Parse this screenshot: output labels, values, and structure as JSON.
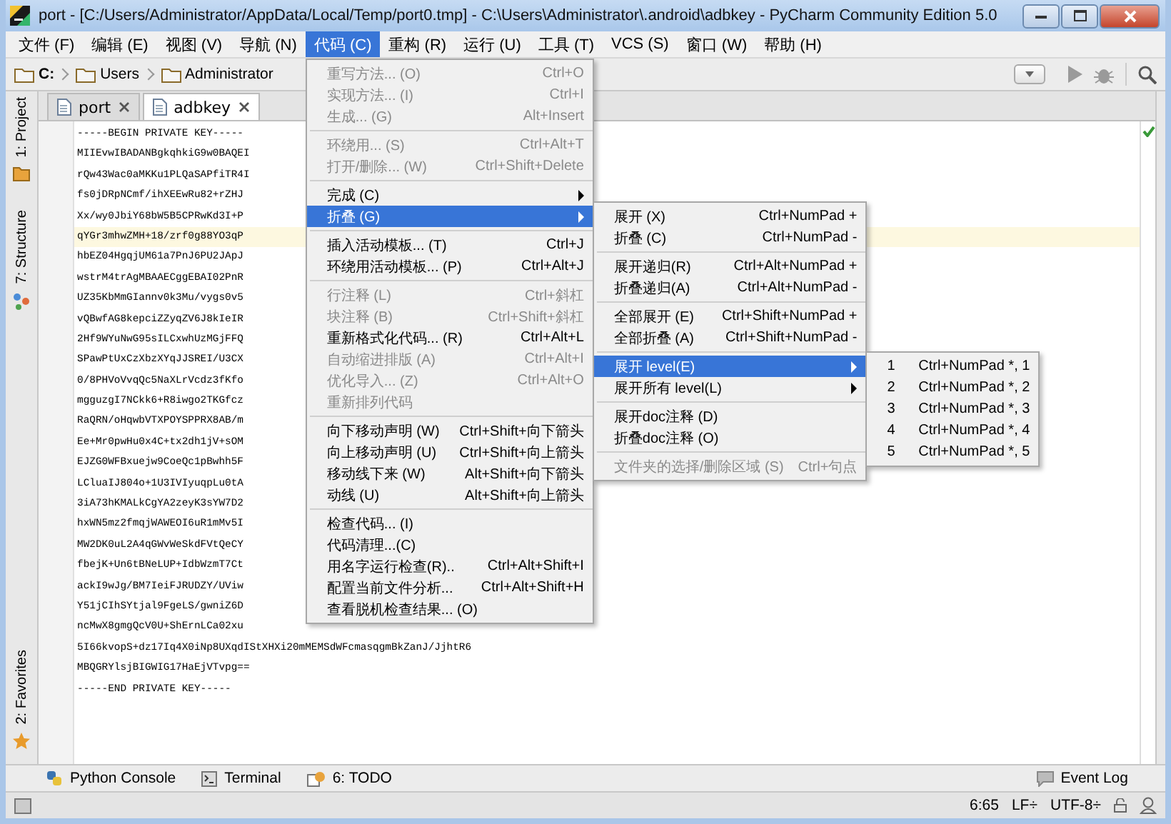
{
  "window": {
    "title": "port - [C:/Users/Administrator/AppData/Local/Temp/port0.tmp] - C:\\Users\\Administrator\\.android\\adbkey - PyCharm Community Edition 5.0"
  },
  "menubar": [
    {
      "label": "文件 (F)",
      "selected": false
    },
    {
      "label": "编辑 (E)",
      "selected": false
    },
    {
      "label": "视图 (V)",
      "selected": false
    },
    {
      "label": "导航 (N)",
      "selected": false
    },
    {
      "label": "代码 (C)",
      "selected": true
    },
    {
      "label": "重构 (R)",
      "selected": false
    },
    {
      "label": "运行 (U)",
      "selected": false
    },
    {
      "label": "工具 (T)",
      "selected": false
    },
    {
      "label": "VCS (S)",
      "selected": false
    },
    {
      "label": "窗口 (W)",
      "selected": false
    },
    {
      "label": "帮助 (H)",
      "selected": false
    }
  ],
  "breadcrumbs": [
    {
      "label": "C:",
      "bold": true
    },
    {
      "label": "Users",
      "bold": false
    },
    {
      "label": "Administrator",
      "bold": false
    }
  ],
  "tabs": [
    {
      "label": "port",
      "selected": false
    },
    {
      "label": "adbkey",
      "selected": true
    }
  ],
  "left_strip": [
    {
      "label": "1: Project",
      "kind": "project"
    },
    {
      "label": "7: Structure",
      "kind": "structure"
    },
    {
      "label": "2: Favorites",
      "kind": "favorites"
    }
  ],
  "editor": {
    "lines": [
      {
        "text": "-----BEGIN PRIVATE KEY-----",
        "current": false
      },
      {
        "text": "MIIEvwIBADANBgkqhkiG9w0BAQEI",
        "current": false
      },
      {
        "text": "rQw43Wac0aMKKu1PLQaSAPfiTR4I",
        "current": false
      },
      {
        "text": "fs0jDRpNCmf/ihXEEwRu82+rZHJ",
        "current": false
      },
      {
        "text": "Xx/wy0JbiY68bW5B5CPRwKd3I+P",
        "current": false
      },
      {
        "text": "qYGr3mhwZMH+18/zrf0g88YO3qP",
        "current": true
      },
      {
        "text": "hbEZ04HgqjUM61a7PnJ6PU2JApJ",
        "current": false
      },
      {
        "text": "wstrM4trAgMBAAECggEBAI02PnR",
        "current": false
      },
      {
        "text": "UZ35KbMmGIannv0k3Mu/vygs0v5",
        "current": false
      },
      {
        "text": "vQBwfAG8kepciZZyqZV6J8kIeIR",
        "current": false
      },
      {
        "text": "2Hf9WYuNwG95sILCxwhUzMGjFFQ",
        "current": false
      },
      {
        "text": "SPawPtUxCzXbzXYqJJSREI/U3CX",
        "current": false
      },
      {
        "text": "0/8PHVoVvqQc5NaXLrVcdz3fKfo",
        "current": false
      },
      {
        "text": "mgguzgI7NCkk6+R8iwgo2TKGfcz",
        "current": false
      },
      {
        "text": "RaQRN/oHqwbVTXPOYSPPRX8AB/m",
        "current": false
      },
      {
        "text": "Ee+Mr0pwHu0x4C+tx2dh1jV+sOM",
        "current": false
      },
      {
        "text": "EJZG0WFBxuejw9CoeQc1pBwhh5F",
        "current": false
      },
      {
        "text": "LCluaIJ804o+1U3IVIyuqpLu0tA",
        "current": false
      },
      {
        "text": "3iA73hKMALkCgYA2zeyK3sYW7D2",
        "current": false
      },
      {
        "text": "hxWN5mz2fmqjWAWEOI6uR1mMv5I",
        "current": false
      },
      {
        "text": "MW2DK0uL2A4qGWvWeSkdFVtQeCY",
        "current": false
      },
      {
        "text": "fbejK+Un6tBNeLUP+IdbWzmT7Ct",
        "current": false
      },
      {
        "text": "ackI9wJg/BM7IeiFJRUDZY/UViw",
        "current": false
      },
      {
        "text": "Y51jCIhSYtjal9FgeLS/gwniZ6D",
        "current": false
      },
      {
        "text": "ncMwX8gmgQcV0U+ShErnLCa02xu",
        "current": false
      },
      {
        "text": "5I66kvopS+dz17Iq4X0iNp8UXqdIStXHXi20mMEMSdWFcmasqgmBkZanJ/JjhtR6",
        "current": false
      },
      {
        "text": "MBQGRYlsjBIGWIG17HaEjVTvpg==",
        "current": false
      },
      {
        "text": "-----END PRIVATE KEY-----",
        "current": false
      }
    ]
  },
  "code_menu": {
    "groups": [
      {
        "items": [
          {
            "label": "重写方法... (O)",
            "shortcut": "Ctrl+O",
            "disabled": true,
            "submenu": false,
            "selected": false
          },
          {
            "label": "实现方法... (I)",
            "shortcut": "Ctrl+I",
            "disabled": true,
            "submenu": false,
            "selected": false
          },
          {
            "label": "生成... (G)",
            "shortcut": "Alt+Insert",
            "disabled": true,
            "submenu": false,
            "selected": false
          }
        ]
      },
      {
        "items": [
          {
            "label": "环绕用... (S)",
            "shortcut": "Ctrl+Alt+T",
            "disabled": true,
            "submenu": false,
            "selected": false
          },
          {
            "label": "打开/删除... (W)",
            "shortcut": "Ctrl+Shift+Delete",
            "disabled": true,
            "submenu": false,
            "selected": false
          }
        ]
      },
      {
        "items": [
          {
            "label": "完成 (C)",
            "disabled": false,
            "submenu": true,
            "selected": false
          },
          {
            "label": "折叠 (G)",
            "disabled": false,
            "submenu": true,
            "selected": true
          }
        ]
      },
      {
        "items": [
          {
            "label": "插入活动模板... (T)",
            "shortcut": "Ctrl+J",
            "disabled": false,
            "submenu": false,
            "selected": false
          },
          {
            "label": "环绕用活动模板... (P)",
            "shortcut": "Ctrl+Alt+J",
            "disabled": false,
            "submenu": false,
            "selected": false
          }
        ]
      },
      {
        "items": [
          {
            "label": "行注释 (L)",
            "shortcut": "Ctrl+斜杠",
            "disabled": true,
            "submenu": false,
            "selected": false
          },
          {
            "label": "块注释 (B)",
            "shortcut": "Ctrl+Shift+斜杠",
            "disabled": true,
            "submenu": false,
            "selected": false
          },
          {
            "label": "重新格式化代码... (R)",
            "shortcut": "Ctrl+Alt+L",
            "disabled": false,
            "submenu": false,
            "selected": false
          },
          {
            "label": "自动缩进排版 (A)",
            "shortcut": "Ctrl+Alt+I",
            "disabled": true,
            "submenu": false,
            "selected": false
          },
          {
            "label": "优化导入... (Z)",
            "shortcut": "Ctrl+Alt+O",
            "disabled": true,
            "submenu": false,
            "selected": false
          },
          {
            "label": "重新排列代码",
            "disabled": true,
            "submenu": false,
            "selected": false
          }
        ]
      },
      {
        "items": [
          {
            "label": "向下移动声明 (W)",
            "shortcut": "Ctrl+Shift+向下箭头",
            "disabled": false,
            "submenu": false,
            "selected": false
          },
          {
            "label": "向上移动声明 (U)",
            "shortcut": "Ctrl+Shift+向上箭头",
            "disabled": false,
            "submenu": false,
            "selected": false
          },
          {
            "label": "移动线下来 (W)",
            "shortcut": "Alt+Shift+向下箭头",
            "disabled": false,
            "submenu": false,
            "selected": false
          },
          {
            "label": "动线 (U)",
            "shortcut": "Alt+Shift+向上箭头",
            "disabled": false,
            "submenu": false,
            "selected": false
          }
        ]
      },
      {
        "items": [
          {
            "label": "检查代码... (I)",
            "disabled": false,
            "submenu": false,
            "selected": false
          },
          {
            "label": "代码清理...(C)",
            "disabled": false,
            "submenu": false,
            "selected": false
          },
          {
            "label": "用名字运行检查(R)..",
            "shortcut": "Ctrl+Alt+Shift+I",
            "disabled": false,
            "submenu": false,
            "selected": false
          },
          {
            "label": "配置当前文件分析...",
            "shortcut": "Ctrl+Alt+Shift+H",
            "disabled": false,
            "submenu": false,
            "selected": false
          },
          {
            "label": "查看脱机检查结果... (O)",
            "disabled": false,
            "submenu": false,
            "selected": false
          }
        ]
      }
    ]
  },
  "fold_menu": {
    "groups": [
      {
        "items": [
          {
            "label": "展开 (X)",
            "shortcut": "Ctrl+NumPad +",
            "disabled": false,
            "submenu": false,
            "selected": false
          },
          {
            "label": "折叠 (C)",
            "shortcut": "Ctrl+NumPad -",
            "disabled": false,
            "submenu": false,
            "selected": false
          }
        ]
      },
      {
        "items": [
          {
            "label": "展开递归(R)",
            "shortcut": "Ctrl+Alt+NumPad +",
            "disabled": false,
            "submenu": false,
            "selected": false
          },
          {
            "label": "折叠递归(A)",
            "shortcut": "Ctrl+Alt+NumPad -",
            "disabled": false,
            "submenu": false,
            "selected": false
          }
        ]
      },
      {
        "items": [
          {
            "label": "全部展开 (E)",
            "shortcut": "Ctrl+Shift+NumPad +",
            "disabled": false,
            "submenu": false,
            "selected": false
          },
          {
            "label": "全部折叠 (A)",
            "shortcut": "Ctrl+Shift+NumPad -",
            "disabled": false,
            "submenu": false,
            "selected": false
          }
        ]
      },
      {
        "items": [
          {
            "label": "展开 level(E)",
            "disabled": false,
            "submenu": true,
            "selected": true
          },
          {
            "label": "展开所有 level(L)",
            "disabled": false,
            "submenu": true,
            "selected": false
          }
        ]
      },
      {
        "items": [
          {
            "label": "展开doc注释 (D)",
            "disabled": false,
            "submenu": false,
            "selected": false
          },
          {
            "label": "折叠doc注释 (O)",
            "disabled": false,
            "submenu": false,
            "selected": false
          }
        ]
      },
      {
        "items": [
          {
            "label": "文件夹的选择/删除区域 (S)",
            "shortcut": "Ctrl+句点",
            "disabled": true,
            "submenu": false,
            "selected": false
          }
        ]
      }
    ]
  },
  "level_menu": {
    "groups": [
      {
        "items": [
          {
            "label": "1",
            "shortcut": "Ctrl+NumPad *, 1",
            "disabled": false,
            "submenu": false,
            "selected": false
          },
          {
            "label": "2",
            "shortcut": "Ctrl+NumPad *, 2",
            "disabled": false,
            "submenu": false,
            "selected": false
          },
          {
            "label": "3",
            "shortcut": "Ctrl+NumPad *, 3",
            "disabled": false,
            "submenu": false,
            "selected": false
          },
          {
            "label": "4",
            "shortcut": "Ctrl+NumPad *, 4",
            "disabled": false,
            "submenu": false,
            "selected": false
          },
          {
            "label": "5",
            "shortcut": "Ctrl+NumPad *, 5",
            "disabled": false,
            "submenu": false,
            "selected": false
          }
        ]
      }
    ]
  },
  "tool_windows": [
    {
      "label": "Python Console",
      "kind": "python"
    },
    {
      "label": "Terminal",
      "kind": "terminal"
    },
    {
      "label": "6: TODO",
      "kind": "todo"
    },
    {
      "label": "Event Log",
      "kind": "eventlog"
    }
  ],
  "status_bar": [
    {
      "text": "6:65"
    },
    {
      "text": "LF÷"
    },
    {
      "text": "UTF-8÷"
    }
  ]
}
